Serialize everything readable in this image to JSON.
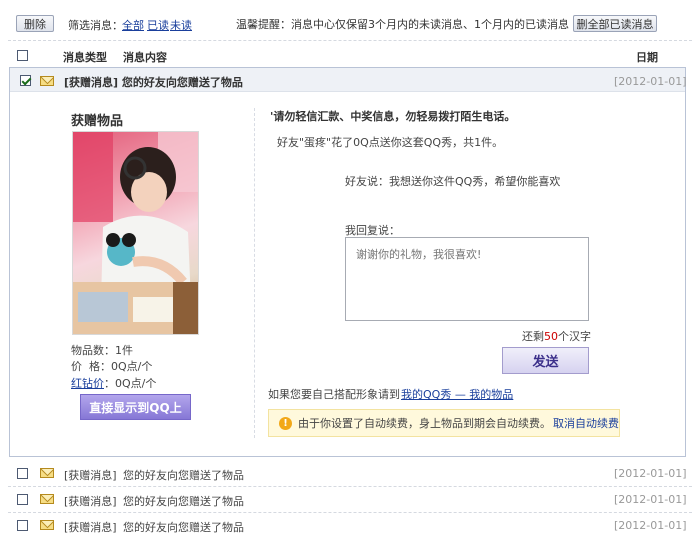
{
  "toolbar": {
    "delete_label": "删除",
    "filter_label": "筛选消息：",
    "filter_all": "全部",
    "filter_read": "已读",
    "filter_unread": "未读",
    "reminder": "温馨提醒：消息中心仅保留3个月内的未读消息、1个月内的已读消息",
    "delete_all_read_label": "删全部已读消息"
  },
  "table_header": {
    "type": "消息类型",
    "content": "消息内容",
    "date": "日期"
  },
  "expanded_message": {
    "title": "[获赠消息] 您的好友向您赠送了物品",
    "date": "[2012-01-01]",
    "gift_heading": "获赠物品",
    "item_count": "物品数：1件",
    "price": "价  格：0Q点/个",
    "red_diamond_link": "红钻价",
    "red_diamond_value": "：0Q点/个",
    "show_on_qq_button": "直接显示到QQ上",
    "warning": "'请勿轻信汇款、中奖信息，勿轻易拨打陌生电话。",
    "gift_info": "好友\"蛋疼\"花了0Q点送你这套QQ秀，共1件。",
    "friend_says": "好友说：我想送你这件QQ秀，希望你能喜欢",
    "reply_label": "我回复说：",
    "reply_placeholder": "谢谢你的礼物，我很喜欢!",
    "remaining_prefix": "还剩",
    "remaining_count": "50",
    "remaining_suffix": "个汉字",
    "send_button": "发送",
    "match_prompt": "如果您要自己搭配形象请到",
    "my_qqshow_link": "我的QQ秀 — 我的物品",
    "notice_text": "由于你设置了自动续费，身上物品到期会自动续费。",
    "cancel_auto_renew": "取消自动续费"
  },
  "message_rows": [
    {
      "type": "[获赠消息]",
      "content": "您的好友向您赠送了物品",
      "date": "[2012-01-01]"
    },
    {
      "type": "[获赠消息]",
      "content": "您的好友向您赠送了物品",
      "date": "[2012-01-01]"
    },
    {
      "type": "[获赠消息]",
      "content": "您的好友向您赠送了物品",
      "date": "[2012-01-01]"
    }
  ],
  "icons": {
    "checkbox": "checkbox-icon",
    "envelope": "envelope-icon",
    "warning": "warning-icon"
  },
  "colors": {
    "link": "#1a3f9c",
    "accent_purple": "#8677d6",
    "remaining_count": "#cc0000"
  }
}
